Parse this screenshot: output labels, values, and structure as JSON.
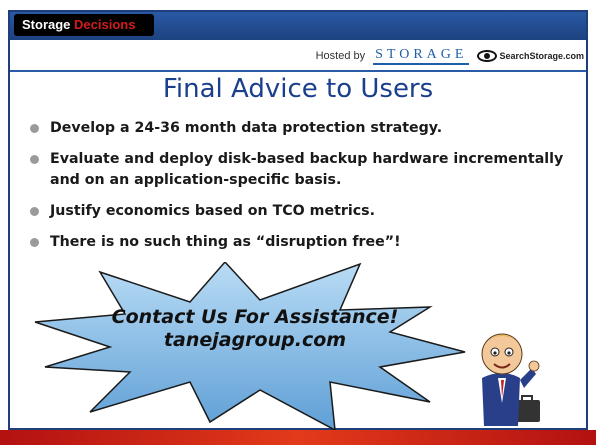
{
  "header": {
    "logo_part1": "Storage",
    "logo_part2": "Decisions",
    "hosted_by": "Hosted by",
    "storage_brand": "STORAGE",
    "searchstorage_brand": "SearchStorage.com"
  },
  "slide": {
    "title": "Final Advice to Users",
    "bullets": [
      "Develop a 24-36 month data protection strategy.",
      "Evaluate and deploy disk-based backup hardware incrementally and on an application-specific basis.",
      "Justify economics based on TCO metrics.",
      "There is no such thing as “disruption free”!"
    ],
    "callout_line1": "Contact Us For Assistance!",
    "callout_line2": "tanejagroup.com"
  },
  "colors": {
    "header_blue": "#1d427f",
    "title_blue": "#1a3f8c",
    "burst_fill": "#8fc0e8",
    "footer_red": "#d62a16",
    "logo_red": "#d11c1c"
  },
  "icons": [
    "searchstorage-eye-icon",
    "businessman-clipart"
  ]
}
